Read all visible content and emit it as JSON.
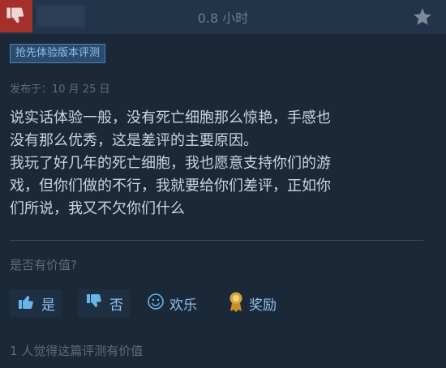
{
  "header": {
    "playtime": "0.8 小时",
    "icons": {
      "vote": "thumbs-down-icon",
      "star": "star-icon"
    },
    "colors": {
      "not_recommended": "#a3302b"
    }
  },
  "review": {
    "badge": "抢先体验版本评测",
    "posted": "发布于：10 月 25 日",
    "text": "说实话体验一般，没有死亡细胞那么惊艳，手感也\n没有那么优秀，这是差评的主要原因。\n我玩了好几年的死亡细胞，我也愿意支持你们的游\n戏，但你们做的不行，我就要给你们差评，正如你\n们所说，我又不欠你们什么"
  },
  "feedback": {
    "question": "是否有价值?",
    "yes_label": "是",
    "no_label": "否",
    "funny_label": "欢乐",
    "award_label": "奖励",
    "found_helpful": "1 人觉得这篇评测有价值"
  }
}
